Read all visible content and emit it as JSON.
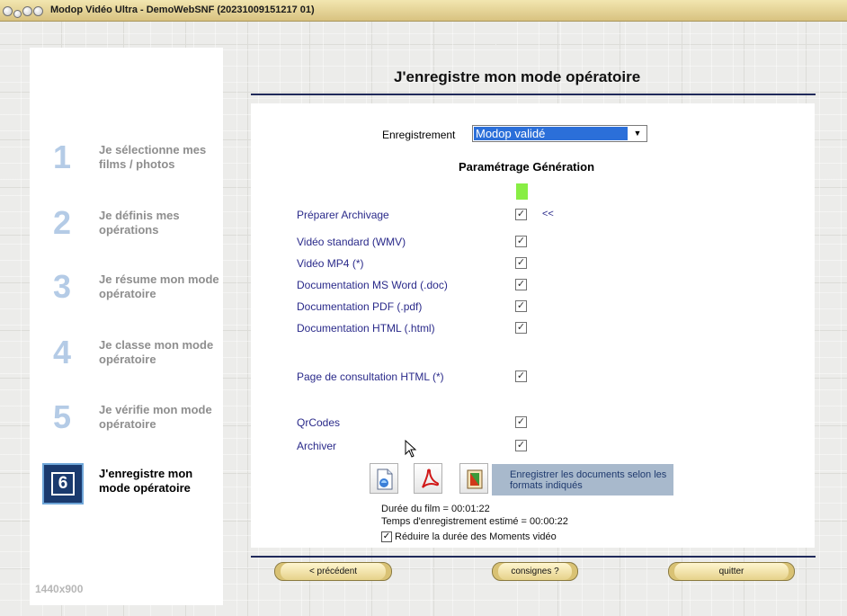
{
  "window": {
    "title": "Modop Vidéo Ultra - DemoWebSNF (20231009151217 01)"
  },
  "sidebar": {
    "steps": [
      {
        "num": "1",
        "label": "Je sélectionne mes films / photos"
      },
      {
        "num": "2",
        "label": "Je définis mes opérations"
      },
      {
        "num": "3",
        "label": "Je résume mon mode opératoire"
      },
      {
        "num": "4",
        "label": "Je classe mon mode opératoire"
      },
      {
        "num": "5",
        "label": "Je vérifie mon mode opératoire"
      },
      {
        "num": "6",
        "label": "J'enregistre mon mode opératoire",
        "active": true
      }
    ],
    "resolution": "1440x900"
  },
  "header": {
    "title": "J'enregistre mon mode opératoire"
  },
  "form": {
    "enregistrement_label": "Enregistrement",
    "enregistrement_value": "Modop validé",
    "section_title": "Paramétrage Génération",
    "back_marker": "<<",
    "options": [
      {
        "label": "Préparer Archivage",
        "checked": true
      },
      {
        "label": "Vidéo standard (WMV)",
        "checked": true
      },
      {
        "label": "Vidéo MP4 (*)",
        "checked": true
      },
      {
        "label": "Documentation MS Word (.doc)",
        "checked": true
      },
      {
        "label": "Documentation PDF (.pdf)",
        "checked": true
      },
      {
        "label": "Documentation HTML (.html)",
        "checked": true
      },
      {
        "label": "Page de consultation HTML (*)",
        "checked": true
      },
      {
        "label": "QrCodes",
        "checked": true
      },
      {
        "label": "Archiver",
        "checked": true
      }
    ],
    "save_banner": "Enregistrer les documents selon les formats indiqués",
    "duree_film": "Durée du film = 00:01:22",
    "temps_estime": "Temps d'enregistrement estimé = 00:00:22",
    "reduce_label": "Réduire la durée des Moments vidéo",
    "reduce_checked": true
  },
  "nav": {
    "prev": "< précédent",
    "consignes": "consignes ?",
    "quit": "quitter"
  },
  "colors": {
    "accent_blue": "#2b6fd9",
    "step_number": "#b4cbe6",
    "green_marker": "#88ee44",
    "banner": "#a8b9cc"
  }
}
